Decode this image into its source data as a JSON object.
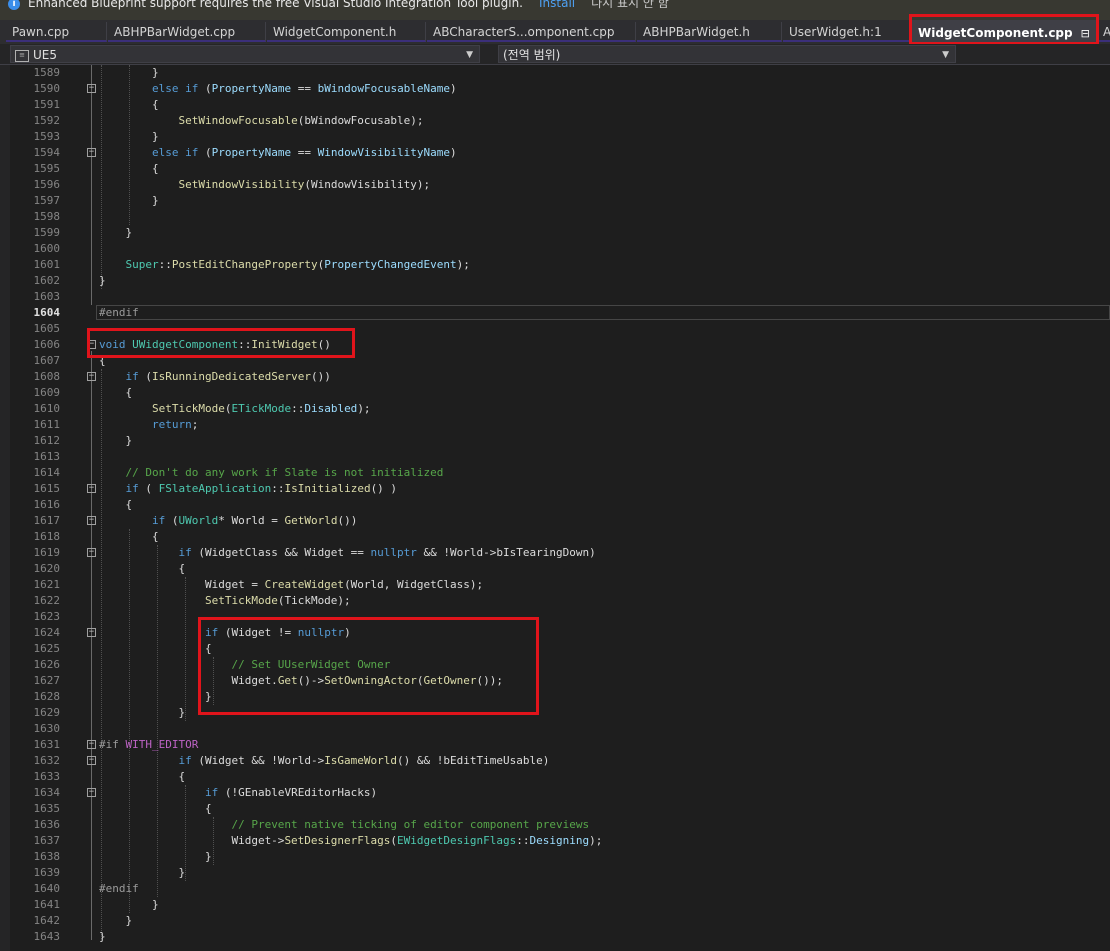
{
  "infobar": {
    "message": "Enhanced Blueprint support requires the free Visual Studio Integration Tool plugin.",
    "install_link": "Install",
    "dismiss_link": "다시 표시 안 함"
  },
  "tabs": [
    {
      "label": "Pawn.cpp",
      "active": false
    },
    {
      "label": "ABHPBarWidget.cpp",
      "active": false
    },
    {
      "label": "WidgetComponent.h",
      "active": false
    },
    {
      "label": "ABCharacterS...omponent.cpp",
      "active": false
    },
    {
      "label": "ABHPBarWidget.h",
      "active": false
    },
    {
      "label": "UserWidget.h:1",
      "active": false
    },
    {
      "label": "WidgetComponent.cpp",
      "active": true
    },
    {
      "label": "A",
      "active": false
    }
  ],
  "navbar": {
    "project": "UE5",
    "scope": "(전역 범위)"
  },
  "icons": {
    "info": "info-icon",
    "pin": "pin-icon",
    "close": "close-icon",
    "dropdown": "chevron-down-icon",
    "fold": "fold-collapse-icon",
    "project": "project-icon"
  },
  "colors": {
    "keyword": "#569cd6",
    "type": "#4ec9b0",
    "function": "#dcdcaa",
    "variable": "#9cdcfe",
    "comment": "#57a64a",
    "highlight_box": "#e0141b"
  },
  "editor": {
    "current_line": "1604",
    "lines": [
      {
        "n": "1589",
        "code": "\t\t}"
      },
      {
        "n": "1590",
        "code": "\t\telse if (PropertyName == bWindowFocusableName)"
      },
      {
        "n": "1591",
        "code": "\t\t{"
      },
      {
        "n": "1592",
        "code": "\t\t\tSetWindowFocusable(bWindowFocusable);"
      },
      {
        "n": "1593",
        "code": "\t\t}"
      },
      {
        "n": "1594",
        "code": "\t\telse if (PropertyName == WindowVisibilityName)"
      },
      {
        "n": "1595",
        "code": "\t\t{"
      },
      {
        "n": "1596",
        "code": "\t\t\tSetWindowVisibility(WindowVisibility);"
      },
      {
        "n": "1597",
        "code": "\t\t}"
      },
      {
        "n": "1598",
        "code": ""
      },
      {
        "n": "1599",
        "code": "\t}"
      },
      {
        "n": "1600",
        "code": ""
      },
      {
        "n": "1601",
        "code": "\tSuper::PostEditChangeProperty(PropertyChangedEvent);"
      },
      {
        "n": "1602",
        "code": "}"
      },
      {
        "n": "1603",
        "code": ""
      },
      {
        "n": "1604",
        "code": "#endif"
      },
      {
        "n": "1605",
        "code": ""
      },
      {
        "n": "1606",
        "code": "void UWidgetComponent::InitWidget()"
      },
      {
        "n": "1607",
        "code": "{"
      },
      {
        "n": "1608",
        "code": "\tif (IsRunningDedicatedServer())"
      },
      {
        "n": "1609",
        "code": "\t{"
      },
      {
        "n": "1610",
        "code": "\t\tSetTickMode(ETickMode::Disabled);"
      },
      {
        "n": "1611",
        "code": "\t\treturn;"
      },
      {
        "n": "1612",
        "code": "\t}"
      },
      {
        "n": "1613",
        "code": ""
      },
      {
        "n": "1614",
        "code": "\t// Don't do any work if Slate is not initialized"
      },
      {
        "n": "1615",
        "code": "\tif ( FSlateApplication::IsInitialized() )"
      },
      {
        "n": "1616",
        "code": "\t{"
      },
      {
        "n": "1617",
        "code": "\t\tif (UWorld* World = GetWorld())"
      },
      {
        "n": "1618",
        "code": "\t\t{"
      },
      {
        "n": "1619",
        "code": "\t\t\tif (WidgetClass && Widget == nullptr && !World->bIsTearingDown)"
      },
      {
        "n": "1620",
        "code": "\t\t\t{"
      },
      {
        "n": "1621",
        "code": "\t\t\t\tWidget = CreateWidget(World, WidgetClass);"
      },
      {
        "n": "1622",
        "code": "\t\t\t\tSetTickMode(TickMode);"
      },
      {
        "n": "1623",
        "code": ""
      },
      {
        "n": "1624",
        "code": "\t\t\t\tif (Widget != nullptr)"
      },
      {
        "n": "1625",
        "code": "\t\t\t\t{"
      },
      {
        "n": "1626",
        "code": "\t\t\t\t\t// Set UUserWidget Owner"
      },
      {
        "n": "1627",
        "code": "\t\t\t\t\tWidget.Get()->SetOwningActor(GetOwner());"
      },
      {
        "n": "1628",
        "code": "\t\t\t\t}"
      },
      {
        "n": "1629",
        "code": "\t\t\t}"
      },
      {
        "n": "1630",
        "code": ""
      },
      {
        "n": "1631",
        "code": "#if WITH_EDITOR"
      },
      {
        "n": "1632",
        "code": "\t\t\tif (Widget && !World->IsGameWorld() && !bEditTimeUsable)"
      },
      {
        "n": "1633",
        "code": "\t\t\t{"
      },
      {
        "n": "1634",
        "code": "\t\t\t\tif (!GEnableVREditorHacks)"
      },
      {
        "n": "1635",
        "code": "\t\t\t\t{"
      },
      {
        "n": "1636",
        "code": "\t\t\t\t\t// Prevent native ticking of editor component previews"
      },
      {
        "n": "1637",
        "code": "\t\t\t\t\tWidget->SetDesignerFlags(EWidgetDesignFlags::Designing);"
      },
      {
        "n": "1638",
        "code": "\t\t\t\t}"
      },
      {
        "n": "1639",
        "code": "\t\t\t}"
      },
      {
        "n": "1640",
        "code": "#endif"
      },
      {
        "n": "1641",
        "code": "\t\t}"
      },
      {
        "n": "1642",
        "code": "\t}"
      },
      {
        "n": "1643",
        "code": "}"
      }
    ]
  }
}
